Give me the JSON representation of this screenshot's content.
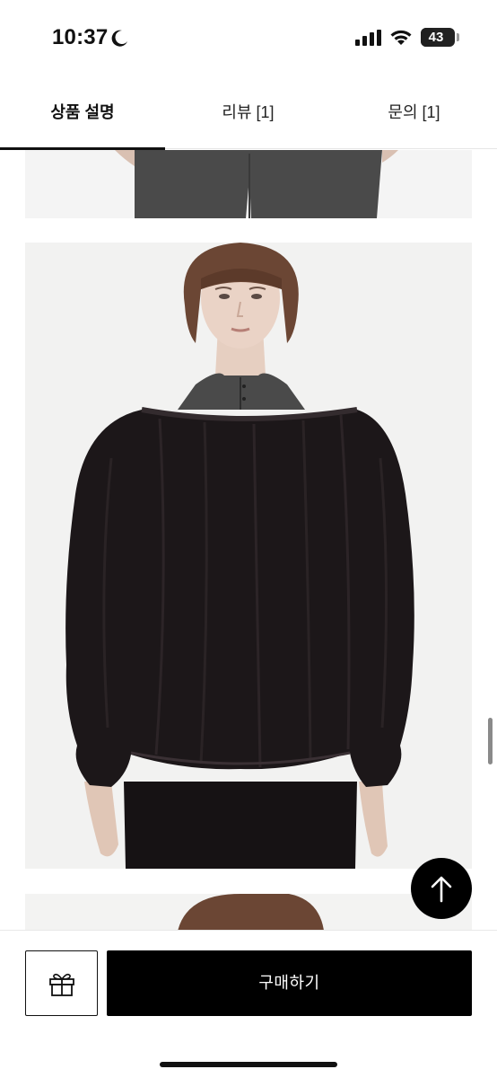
{
  "status_bar": {
    "time": "10:37",
    "battery_percent": 43,
    "battery_label": "43",
    "icons": [
      "moon-icon",
      "signal-icon",
      "wifi-icon",
      "battery-icon"
    ]
  },
  "tabs": [
    {
      "label": "상품 설명",
      "active": true
    },
    {
      "label": "리뷰 [1]",
      "active": false
    },
    {
      "label": "문의 [1]",
      "active": false
    }
  ],
  "scroll_to_top": {
    "icon": "arrow-up-icon"
  },
  "bottom_bar": {
    "gift_icon": "gift-icon",
    "buy_label": "구매하기"
  },
  "colors": {
    "accent": "#000000",
    "background": "#ffffff",
    "image_background": "#f2f2f1"
  }
}
